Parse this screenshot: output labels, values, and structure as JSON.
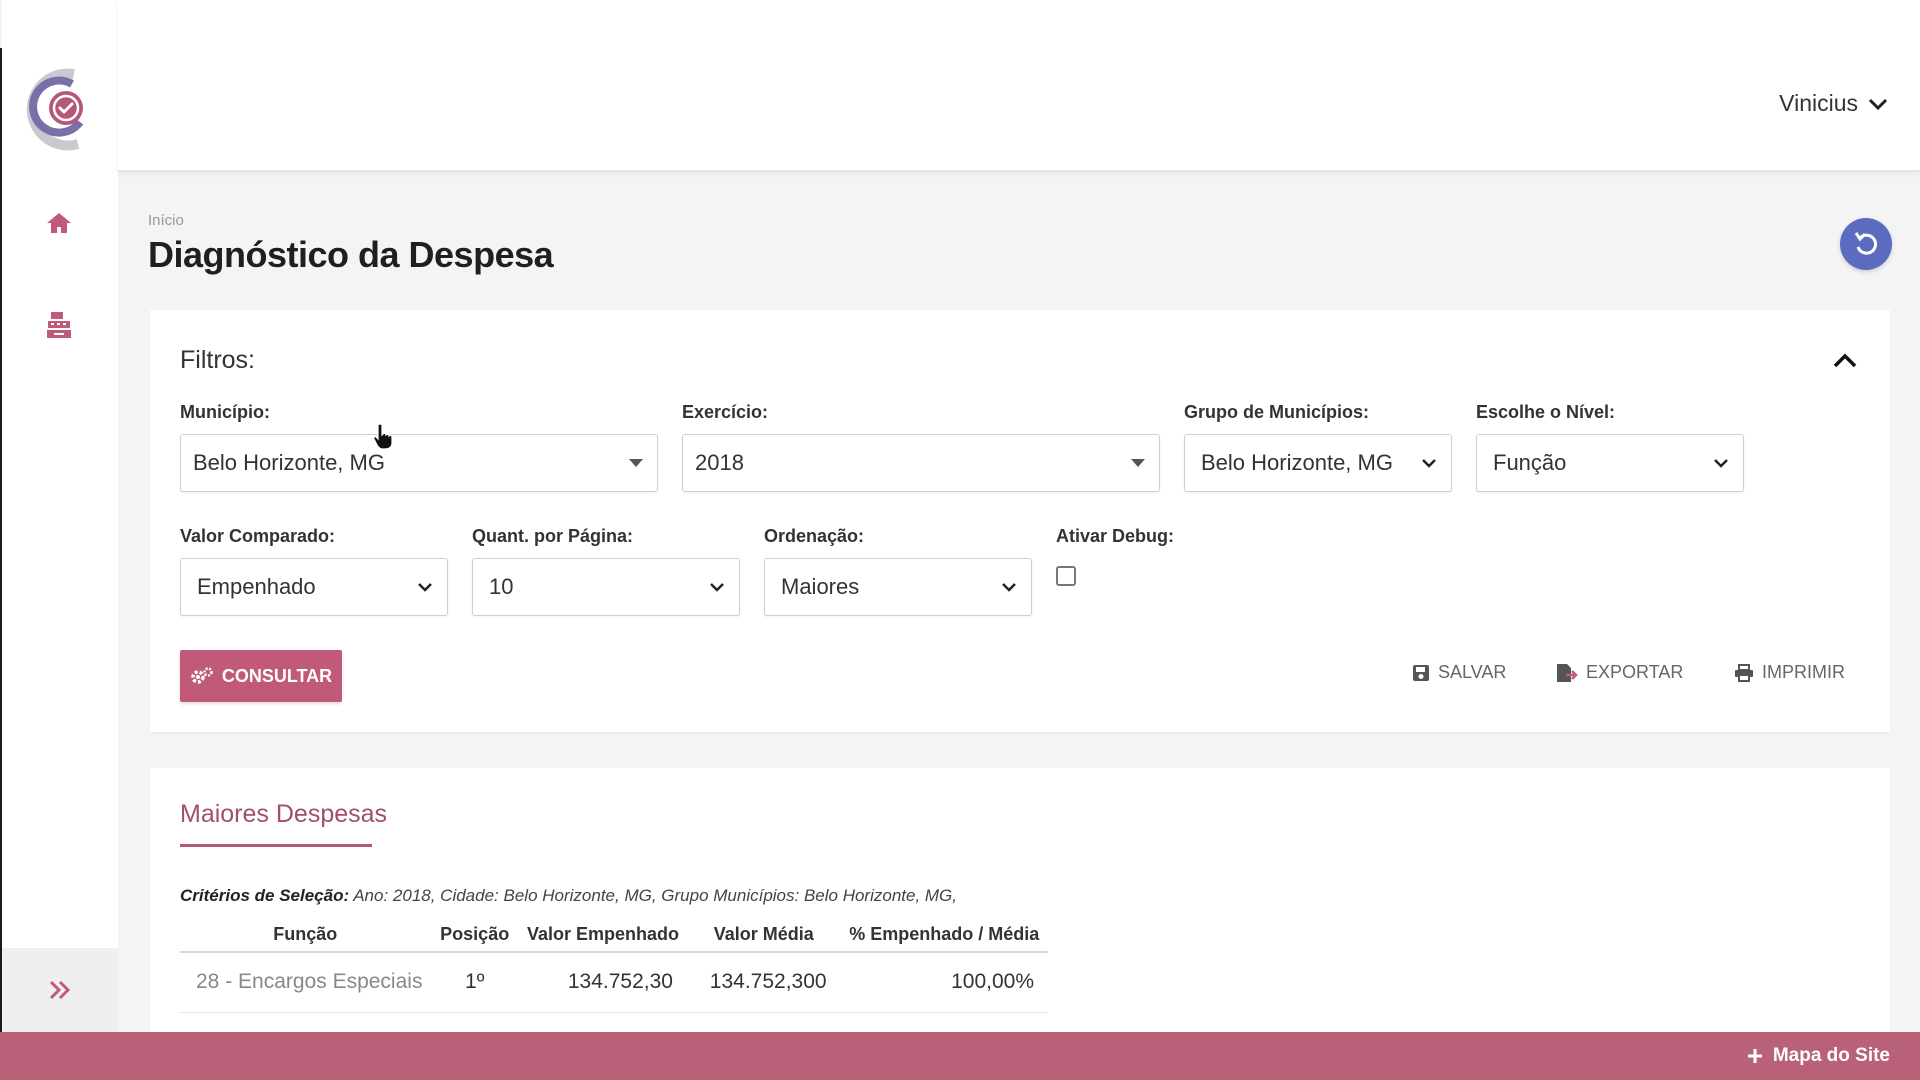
{
  "header": {
    "user_name": "Vinicius"
  },
  "page": {
    "breadcrumb": "Início",
    "title": "Diagnóstico da Despesa"
  },
  "filters": {
    "title": "Filtros:",
    "municipio": {
      "label": "Município:",
      "value": "Belo Horizonte, MG"
    },
    "exercicio": {
      "label": "Exercício:",
      "value": "2018"
    },
    "grupo": {
      "label": "Grupo de Municípios:",
      "value": "Belo Horizonte, MG"
    },
    "nivel": {
      "label": "Escolhe o Nível:",
      "value": "Função"
    },
    "valor_comparado": {
      "label": "Valor Comparado:",
      "value": "Empenhado"
    },
    "quant_pagina": {
      "label": "Quant. por Página:",
      "value": "10"
    },
    "ordenacao": {
      "label": "Ordenação:",
      "value": "Maiores"
    },
    "debug": {
      "label": "Ativar Debug:",
      "checked": false
    },
    "consultar_label": "CONSULTAR",
    "salvar_label": "SALVAR",
    "exportar_label": "EXPORTAR",
    "imprimir_label": "IMPRIMIR"
  },
  "results": {
    "tab_title": "Maiores Despesas",
    "criteria_label": "Critérios de Seleção:",
    "criteria_text": " Ano: 2018, Cidade: Belo Horizonte, MG, Grupo Municípios: Belo Horizonte, MG,",
    "columns": [
      "Função",
      "Posição",
      "Valor Empenhado",
      "Valor Média",
      "% Empenhado / Média"
    ],
    "rows": [
      [
        "28 - Encargos Especiais",
        "1º",
        "134.752,30",
        "134.752,300",
        "100,00%"
      ]
    ]
  },
  "footer": {
    "sitemap_label": "Mapa do Site"
  },
  "colors": {
    "brand": "#b86179",
    "button": "#c05a78",
    "refresh": "#5b6cc0",
    "icon": "#c05a78"
  }
}
